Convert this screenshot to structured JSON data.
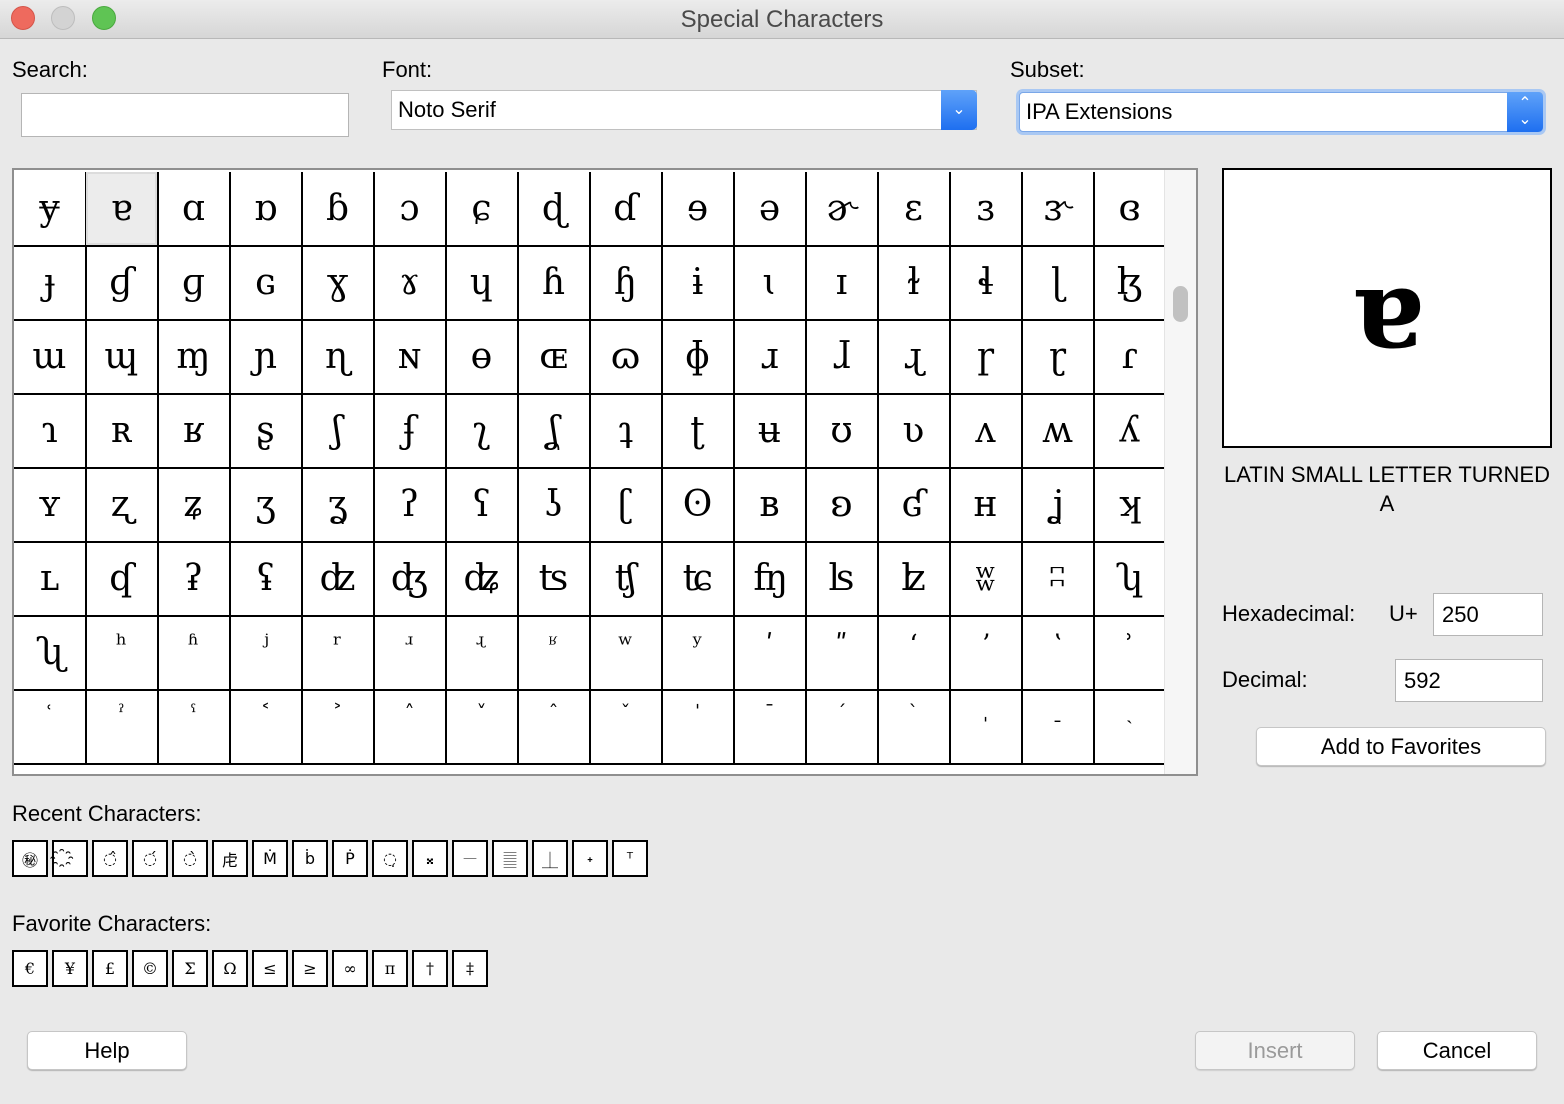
{
  "window": {
    "title": "Special Characters",
    "buttons": {
      "close": "close",
      "minimize": "minimize",
      "zoom": "zoom"
    }
  },
  "search": {
    "label": "Search:",
    "value": "",
    "placeholder": ""
  },
  "font": {
    "label": "Font:",
    "selected": "Noto Serif",
    "icon": "chevron-down-icon"
  },
  "subset": {
    "label": "Subset:",
    "selected": "IPA Extensions",
    "icon": "up-down-chevron-icon"
  },
  "grid": {
    "selected_index": 1,
    "rows": [
      [
        "ɏ",
        "ɐ",
        "ɑ",
        "ɒ",
        "ɓ",
        "ɔ",
        "ɕ",
        "ɖ",
        "ɗ",
        "ɘ",
        "ə",
        "ɚ",
        "ɛ",
        "ɜ",
        "ɝ",
        "ɞ"
      ],
      [
        "ɟ",
        "ɠ",
        "ɡ",
        "ɢ",
        "ɣ",
        "ɤ",
        "ɥ",
        "ɦ",
        "ɧ",
        "ɨ",
        "ɩ",
        "ɪ",
        "ɫ",
        "ɬ",
        "ɭ",
        "ɮ"
      ],
      [
        "ɯ",
        "ɰ",
        "ɱ",
        "ɲ",
        "ɳ",
        "ɴ",
        "ɵ",
        "ɶ",
        "ɷ",
        "ɸ",
        "ɹ",
        "ɺ",
        "ɻ",
        "ɼ",
        "ɽ",
        "ɾ"
      ],
      [
        "ɿ",
        "ʀ",
        "ʁ",
        "ʂ",
        "ʃ",
        "ʄ",
        "ʅ",
        "ʆ",
        "ʇ",
        "ʈ",
        "ʉ",
        "ʊ",
        "ʋ",
        "ʌ",
        "ʍ",
        "ʎ"
      ],
      [
        "ʏ",
        "ʐ",
        "ʑ",
        "ʒ",
        "ʓ",
        "ʔ",
        "ʕ",
        "ʖ",
        "ʗ",
        "ʘ",
        "ʙ",
        "ʚ",
        "ʛ",
        "ʜ",
        "ʝ",
        "ʞ"
      ],
      [
        "ʟ",
        "ʠ",
        "ʡ",
        "ʢ",
        "ʣ",
        "ʤ",
        "ʥ",
        "ʦ",
        "ʧ",
        "ʨ",
        "ʩ",
        "ʪ",
        "ʫ",
        "ʬ",
        "ʭ",
        "ʮ"
      ],
      [
        "ʯ",
        "ʰ",
        "ʱ",
        "ʲ",
        "ʳ",
        "ʴ",
        "ʵ",
        "ʶ",
        "ʷ",
        "ʸ",
        "ʹ",
        "ʺ",
        "ʻ",
        "ʼ",
        "ʽ",
        "ʾ"
      ],
      [
        "ʿ",
        "ˀ",
        "ˁ",
        "˂",
        "˃",
        "˄",
        "˅",
        "ˆ",
        "ˇ",
        "ˈ",
        "ˉ",
        "ˊ",
        "ˋ",
        "ˌ",
        "ˍ",
        "ˎ"
      ]
    ]
  },
  "preview": {
    "char": "ɐ",
    "name": "LATIN SMALL LETTER TURNED A"
  },
  "codes": {
    "hex_label": "Hexadecimal:",
    "hex_prefix": "U+",
    "hex_value": "250",
    "dec_label": "Decimal:",
    "dec_value": "592"
  },
  "add_favorites_label": "Add to Favorites",
  "recent": {
    "label": "Recent Characters:",
    "items": [
      "㊙",
      "҈",
      "◌̂",
      "◌́",
      "◌̀",
      "⾌",
      "Ṁ",
      "ḃ",
      "Ṗ",
      "◌̣",
      "𝄪",
      "𝄖",
      "𝄛",
      "⏊",
      "˖",
      "ᵀ"
    ]
  },
  "favorites": {
    "label": "Favorite Characters:",
    "items": [
      "€",
      "¥",
      "£",
      "©",
      "Σ",
      "Ω",
      "≤",
      "≥",
      "∞",
      "π",
      "†",
      "‡"
    ]
  },
  "footer": {
    "help": "Help",
    "insert": "Insert",
    "cancel": "Cancel"
  }
}
